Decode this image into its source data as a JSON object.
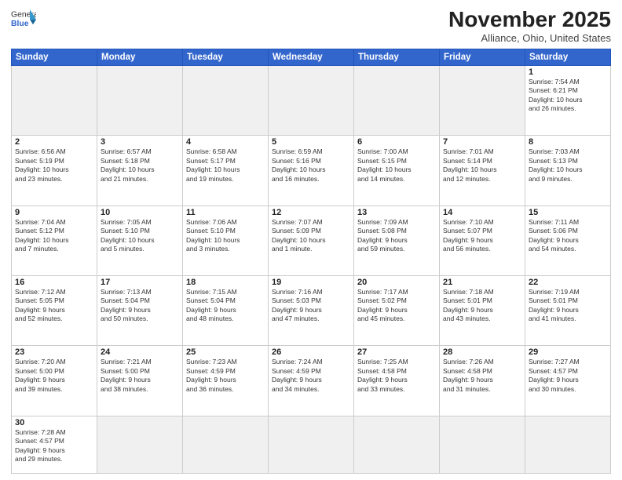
{
  "app": {
    "logo_general": "General",
    "logo_blue": "Blue"
  },
  "header": {
    "month_year": "November 2025",
    "location": "Alliance, Ohio, United States"
  },
  "weekdays": [
    "Sunday",
    "Monday",
    "Tuesday",
    "Wednesday",
    "Thursday",
    "Friday",
    "Saturday"
  ],
  "weeks": [
    [
      {
        "day": "",
        "info": ""
      },
      {
        "day": "",
        "info": ""
      },
      {
        "day": "",
        "info": ""
      },
      {
        "day": "",
        "info": ""
      },
      {
        "day": "",
        "info": ""
      },
      {
        "day": "",
        "info": ""
      },
      {
        "day": "1",
        "info": "Sunrise: 7:54 AM\nSunset: 6:21 PM\nDaylight: 10 hours\nand 26 minutes."
      }
    ],
    [
      {
        "day": "2",
        "info": "Sunrise: 6:56 AM\nSunset: 5:19 PM\nDaylight: 10 hours\nand 23 minutes."
      },
      {
        "day": "3",
        "info": "Sunrise: 6:57 AM\nSunset: 5:18 PM\nDaylight: 10 hours\nand 21 minutes."
      },
      {
        "day": "4",
        "info": "Sunrise: 6:58 AM\nSunset: 5:17 PM\nDaylight: 10 hours\nand 19 minutes."
      },
      {
        "day": "5",
        "info": "Sunrise: 6:59 AM\nSunset: 5:16 PM\nDaylight: 10 hours\nand 16 minutes."
      },
      {
        "day": "6",
        "info": "Sunrise: 7:00 AM\nSunset: 5:15 PM\nDaylight: 10 hours\nand 14 minutes."
      },
      {
        "day": "7",
        "info": "Sunrise: 7:01 AM\nSunset: 5:14 PM\nDaylight: 10 hours\nand 12 minutes."
      },
      {
        "day": "8",
        "info": "Sunrise: 7:03 AM\nSunset: 5:13 PM\nDaylight: 10 hours\nand 9 minutes."
      }
    ],
    [
      {
        "day": "9",
        "info": "Sunrise: 7:04 AM\nSunset: 5:12 PM\nDaylight: 10 hours\nand 7 minutes."
      },
      {
        "day": "10",
        "info": "Sunrise: 7:05 AM\nSunset: 5:10 PM\nDaylight: 10 hours\nand 5 minutes."
      },
      {
        "day": "11",
        "info": "Sunrise: 7:06 AM\nSunset: 5:10 PM\nDaylight: 10 hours\nand 3 minutes."
      },
      {
        "day": "12",
        "info": "Sunrise: 7:07 AM\nSunset: 5:09 PM\nDaylight: 10 hours\nand 1 minute."
      },
      {
        "day": "13",
        "info": "Sunrise: 7:09 AM\nSunset: 5:08 PM\nDaylight: 9 hours\nand 59 minutes."
      },
      {
        "day": "14",
        "info": "Sunrise: 7:10 AM\nSunset: 5:07 PM\nDaylight: 9 hours\nand 56 minutes."
      },
      {
        "day": "15",
        "info": "Sunrise: 7:11 AM\nSunset: 5:06 PM\nDaylight: 9 hours\nand 54 minutes."
      }
    ],
    [
      {
        "day": "16",
        "info": "Sunrise: 7:12 AM\nSunset: 5:05 PM\nDaylight: 9 hours\nand 52 minutes."
      },
      {
        "day": "17",
        "info": "Sunrise: 7:13 AM\nSunset: 5:04 PM\nDaylight: 9 hours\nand 50 minutes."
      },
      {
        "day": "18",
        "info": "Sunrise: 7:15 AM\nSunset: 5:04 PM\nDaylight: 9 hours\nand 48 minutes."
      },
      {
        "day": "19",
        "info": "Sunrise: 7:16 AM\nSunset: 5:03 PM\nDaylight: 9 hours\nand 47 minutes."
      },
      {
        "day": "20",
        "info": "Sunrise: 7:17 AM\nSunset: 5:02 PM\nDaylight: 9 hours\nand 45 minutes."
      },
      {
        "day": "21",
        "info": "Sunrise: 7:18 AM\nSunset: 5:01 PM\nDaylight: 9 hours\nand 43 minutes."
      },
      {
        "day": "22",
        "info": "Sunrise: 7:19 AM\nSunset: 5:01 PM\nDaylight: 9 hours\nand 41 minutes."
      }
    ],
    [
      {
        "day": "23",
        "info": "Sunrise: 7:20 AM\nSunset: 5:00 PM\nDaylight: 9 hours\nand 39 minutes."
      },
      {
        "day": "24",
        "info": "Sunrise: 7:21 AM\nSunset: 5:00 PM\nDaylight: 9 hours\nand 38 minutes."
      },
      {
        "day": "25",
        "info": "Sunrise: 7:23 AM\nSunset: 4:59 PM\nDaylight: 9 hours\nand 36 minutes."
      },
      {
        "day": "26",
        "info": "Sunrise: 7:24 AM\nSunset: 4:59 PM\nDaylight: 9 hours\nand 34 minutes."
      },
      {
        "day": "27",
        "info": "Sunrise: 7:25 AM\nSunset: 4:58 PM\nDaylight: 9 hours\nand 33 minutes."
      },
      {
        "day": "28",
        "info": "Sunrise: 7:26 AM\nSunset: 4:58 PM\nDaylight: 9 hours\nand 31 minutes."
      },
      {
        "day": "29",
        "info": "Sunrise: 7:27 AM\nSunset: 4:57 PM\nDaylight: 9 hours\nand 30 minutes."
      }
    ],
    [
      {
        "day": "30",
        "info": "Sunrise: 7:28 AM\nSunset: 4:57 PM\nDaylight: 9 hours\nand 29 minutes."
      },
      {
        "day": "",
        "info": ""
      },
      {
        "day": "",
        "info": ""
      },
      {
        "day": "",
        "info": ""
      },
      {
        "day": "",
        "info": ""
      },
      {
        "day": "",
        "info": ""
      },
      {
        "day": "",
        "info": ""
      }
    ]
  ]
}
